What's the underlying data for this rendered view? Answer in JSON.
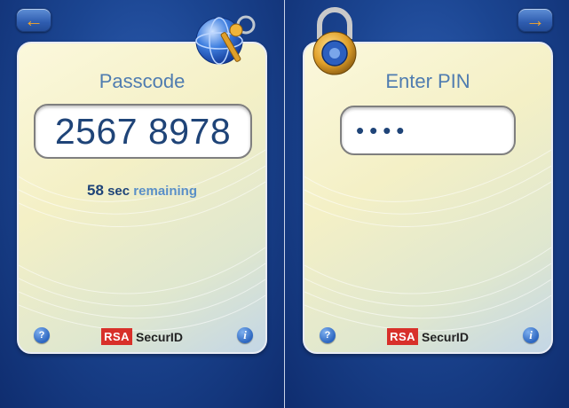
{
  "left_screen": {
    "back_arrow": "←",
    "title": "Passcode",
    "passcode": "2567 8978",
    "countdown_seconds": "58",
    "countdown_unit": "sec",
    "countdown_word": "remaining",
    "help": "?",
    "info": "i",
    "brand_rsa": "RSA",
    "brand_product": "SecurID"
  },
  "right_screen": {
    "forward_arrow": "→",
    "title": "Enter PIN",
    "pin_masked": "••••",
    "help": "?",
    "info": "i",
    "brand_rsa": "RSA",
    "brand_product": "SecurID"
  },
  "icons": {
    "left_decoration": "globe-key-icon",
    "right_decoration": "padlock-icon"
  },
  "colors": {
    "background": "#1b4591",
    "card": "#f4f0c6",
    "accent_arrow": "#f4a52a",
    "text_blue": "#1f4478",
    "brand_red": "#d8302a"
  }
}
